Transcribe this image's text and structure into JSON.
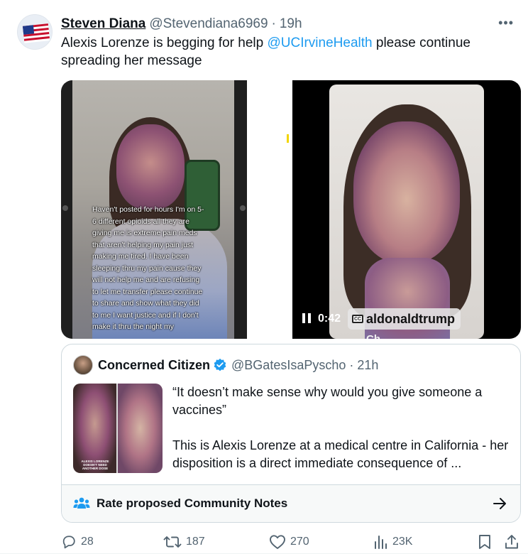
{
  "tweet": {
    "author_name": "Steven Diana",
    "author_handle": "@Stevendiana6969",
    "separator": "·",
    "time": "19h",
    "more": "•••",
    "text_prefix": "Alexis Lorenze is begging for help ",
    "mention": "@UCIrvineHealth",
    "text_suffix": "  please continue spreading her message",
    "story_text": "Haven't posted for hours I'm on 5-6 different opioids all they are giving me is extreme pain meds that aren't helping my pain just making me tired. I have been sleeping thru my pain cause they will not help me and are refusing to let me transfer please continue to share and show what they did to me I want justice and if I don't make it thru the night my",
    "video": {
      "time": "0:42",
      "cc_label": "CC",
      "overlay_text": "aldonaldtrump",
      "partial_text": "Ch..."
    },
    "actions": {
      "replies": "28",
      "reposts": "187",
      "likes": "270",
      "views": "23K"
    }
  },
  "quote": {
    "author_name": "Concerned Citizen",
    "author_handle": "@BGatesIsaPyscho",
    "separator": "·",
    "time": "21h",
    "paragraph1": "“It doesn’t make sense why would you give someone a vaccines”",
    "paragraph2": "This is Alexis Lorenze at a medical centre in California - her disposition is a direct immediate consequence of ...",
    "thumb_caption": "ALEXIS LORENZE DOESN'T NEED ANOTHER DOSE"
  },
  "community_notes": {
    "label": "Rate proposed Community Notes"
  },
  "colors": {
    "accent": "#1d9bf0",
    "text": "#0f1419",
    "muted": "#536471",
    "border": "#cfd9de"
  }
}
